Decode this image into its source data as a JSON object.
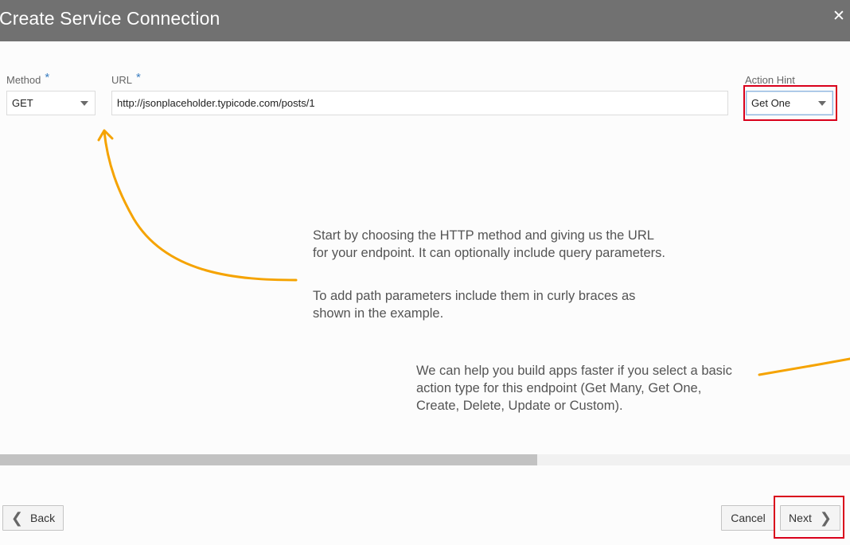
{
  "dialog": {
    "title": "Create Service Connection",
    "close_icon": "close-icon"
  },
  "form": {
    "method": {
      "label": "Method",
      "required_mark": "*",
      "value": "GET"
    },
    "url": {
      "label": "URL",
      "required_mark": "*",
      "value": "http://jsonplaceholder.typicode.com/posts/1"
    },
    "action_hint": {
      "label": "Action Hint",
      "value": "Get One"
    }
  },
  "help": {
    "url_text_1": "Start by choosing the HTTP method and giving us the URL for your endpoint. It can optionally include query parameters.",
    "url_text_2": "To add path parameters include them in curly braces as shown in the example.",
    "action_text": "We can help you build apps faster if you select a basic action type for this endpoint (Get Many, Get One, Create, Delete, Update or Custom)."
  },
  "footer": {
    "back_label": "Back",
    "cancel_label": "Cancel",
    "next_label": "Next"
  },
  "colors": {
    "titlebar": "#717171",
    "accent_arrow": "#f5a300",
    "highlight": "#d9001b",
    "required": "#3d7fc1"
  }
}
